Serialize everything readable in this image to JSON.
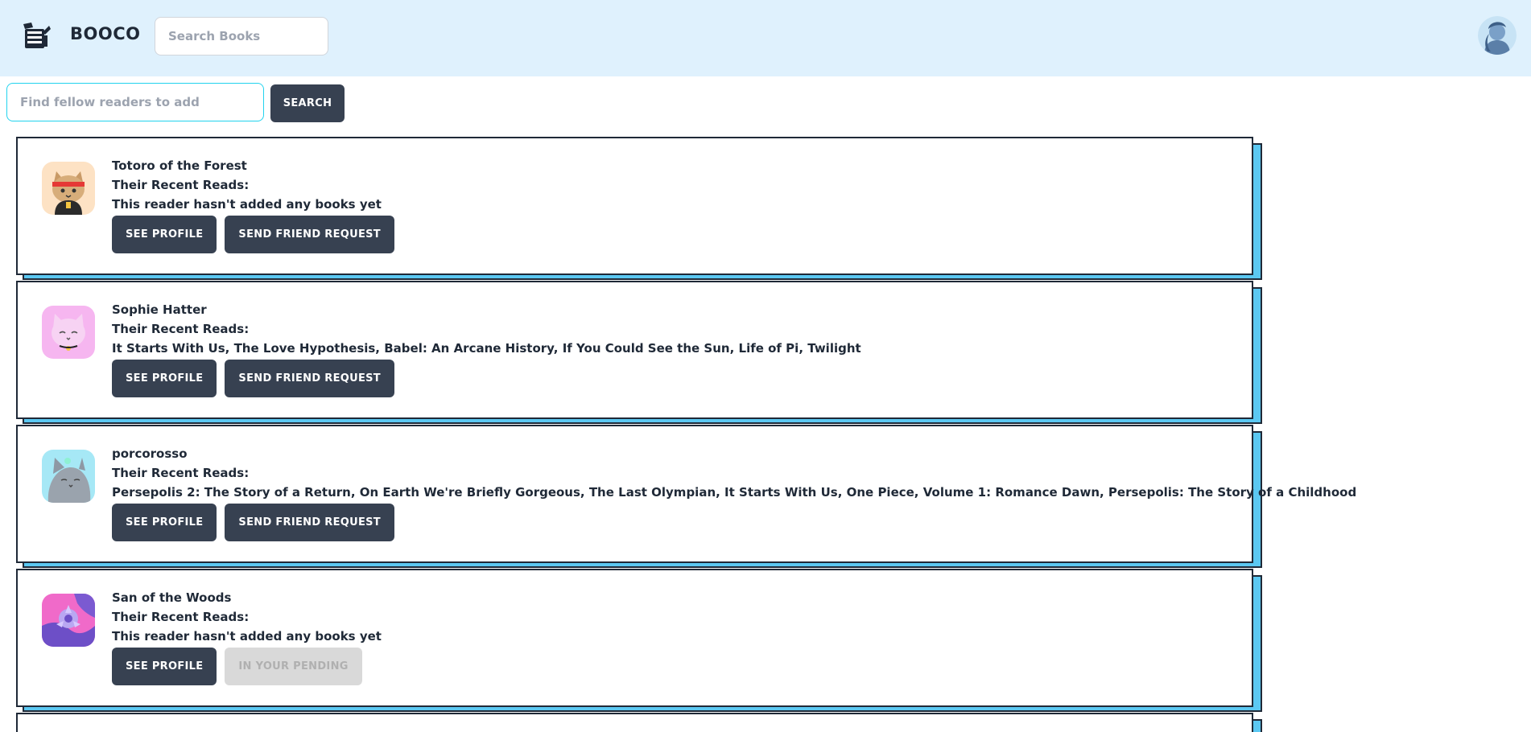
{
  "header": {
    "brand": "BOOCO",
    "search_placeholder": "Search Books",
    "logo_icon": "books-logo-icon",
    "colors": {
      "header_bg": "#dff1fd",
      "accent": "#5bc8f2",
      "button": "#374151"
    }
  },
  "friend_search": {
    "placeholder": "Find fellow readers to add",
    "button_label": "SEARCH"
  },
  "readers": [
    {
      "name": "Totoro of the Forest",
      "recent_label": "Their Recent Reads:",
      "reads": "This reader hasn't added any books yet",
      "profile_label": "SEE PROFILE",
      "action_label": "SEND FRIEND REQUEST",
      "action_disabled": false,
      "avatar": "cat-headband-avatar"
    },
    {
      "name": "Sophie Hatter",
      "recent_label": "Their Recent Reads:",
      "reads": "It Starts With Us, The Love Hypothesis, Babel: An Arcane History, If You Could See the Sun, Life of Pi, Twilight",
      "profile_label": "SEE PROFILE",
      "action_label": "SEND FRIEND REQUEST",
      "action_disabled": false,
      "avatar": "pink-cat-avatar"
    },
    {
      "name": "porcorosso",
      "recent_label": "Their Recent Reads:",
      "reads": "Persepolis 2: The Story of a Return, On Earth We're Briefly Gorgeous, The Last Olympian, It Starts With Us, One Piece, Volume 1: Romance Dawn, Persepolis: The Story of a Childhood",
      "profile_label": "SEE PROFILE",
      "action_label": "SEND FRIEND REQUEST",
      "action_disabled": false,
      "avatar": "grey-cat-avatar"
    },
    {
      "name": "San of the Woods",
      "recent_label": "Their Recent Reads:",
      "reads": "This reader hasn't added any books yet",
      "profile_label": "SEE PROFILE",
      "action_label": "IN YOUR PENDING",
      "action_disabled": true,
      "avatar": "purple-abstract-avatar"
    }
  ]
}
